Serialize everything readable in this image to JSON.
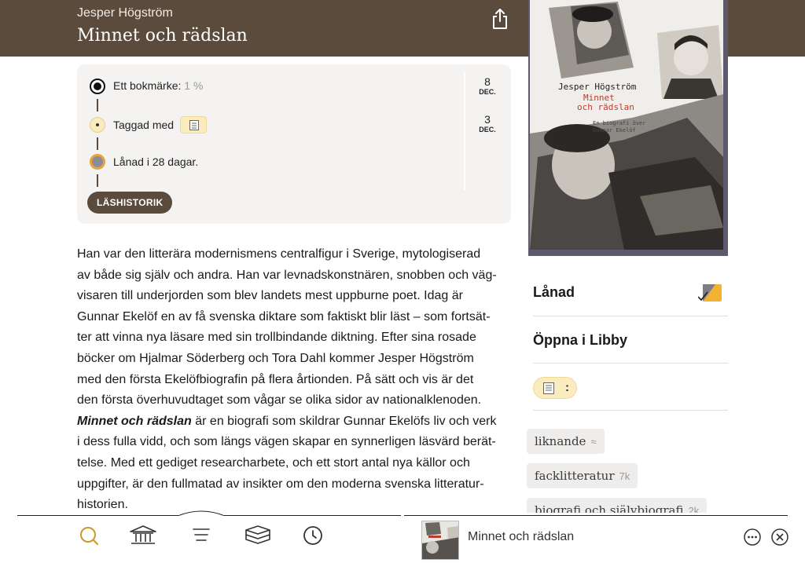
{
  "header": {
    "author": "Jesper Högström",
    "title": "Minnet och rädslan"
  },
  "cover": {
    "author": "Jesper Högström",
    "title_line1": "Minnet",
    "title_line2": "och rädslan",
    "subtitle_line1": "En biografi över",
    "subtitle_line2": "Gunnar Ekelöf"
  },
  "history": {
    "items": [
      {
        "label": "Ett bokmärke:",
        "detail": "1 %"
      },
      {
        "label": "Taggad med",
        "detail": ""
      },
      {
        "label": "Lånad i 28 dagar.",
        "detail": ""
      }
    ],
    "button_label": "LÄSHISTORIK",
    "dates": [
      {
        "day": "8",
        "month": "DEC."
      },
      {
        "day": "3",
        "month": "DEC."
      }
    ]
  },
  "description": {
    "lines": [
      "Han var den litterära modernismens centralfigur i Sverige, mytologiserad",
      "av både sig själv och andra. Han var levnadskonstnären, snobben och väg-",
      "visaren till underjorden som blev landets mest uppburne poet. Idag är",
      "Gunnar Ekelöf en av få svenska diktare som faktiskt blir läst – som fortsät-",
      "ter att vinna nya läsare med sin trollbindande diktning. Efter sina rosade",
      "böcker om Hjalmar Söderberg och Tora Dahl kommer Jesper Högström",
      "med den första Ekelöfbiografin på flera årtionden. På sätt och vis är det",
      "den första överhuvudtaget som vågar se olika sidor av nationalklenoden."
    ],
    "emph": "Minnet och rädslan",
    "lines2": [
      " är en biografi som skildrar Gunnar Ekelöfs liv och verk",
      "i dess fulla vidd, och som längs vägen skapar en synnerligen läsvärd berät-",
      "telse. Med ett gediget researcharbete, och ett stort antal nya källor och",
      "uppgifter, är den fullmatad av insikter om den moderna svenska litteratur-",
      "historien."
    ]
  },
  "side": {
    "loaned_label": "Lånad",
    "open_libby_label": "Öppna i Libby",
    "tag_more": ":"
  },
  "subjects": [
    {
      "label": "liknande",
      "count": "≈"
    },
    {
      "label": "facklitteratur",
      "count": "7k"
    },
    {
      "label": "biografi och självbiografi",
      "count": "2k"
    }
  ],
  "bottom": {
    "now_title": "Minnet och rädslan"
  },
  "colors": {
    "header_bg": "#5b4b3c",
    "tag_yellow": "#fbecc0",
    "accent_gold": "#c79a2e"
  },
  "icons": {
    "share": "share-icon",
    "search": "search-icon",
    "library": "library-icon",
    "menu": "menu-icon",
    "shelf": "shelf-icon",
    "timeline": "clock-icon",
    "more": "more-icon",
    "close": "close-icon"
  }
}
